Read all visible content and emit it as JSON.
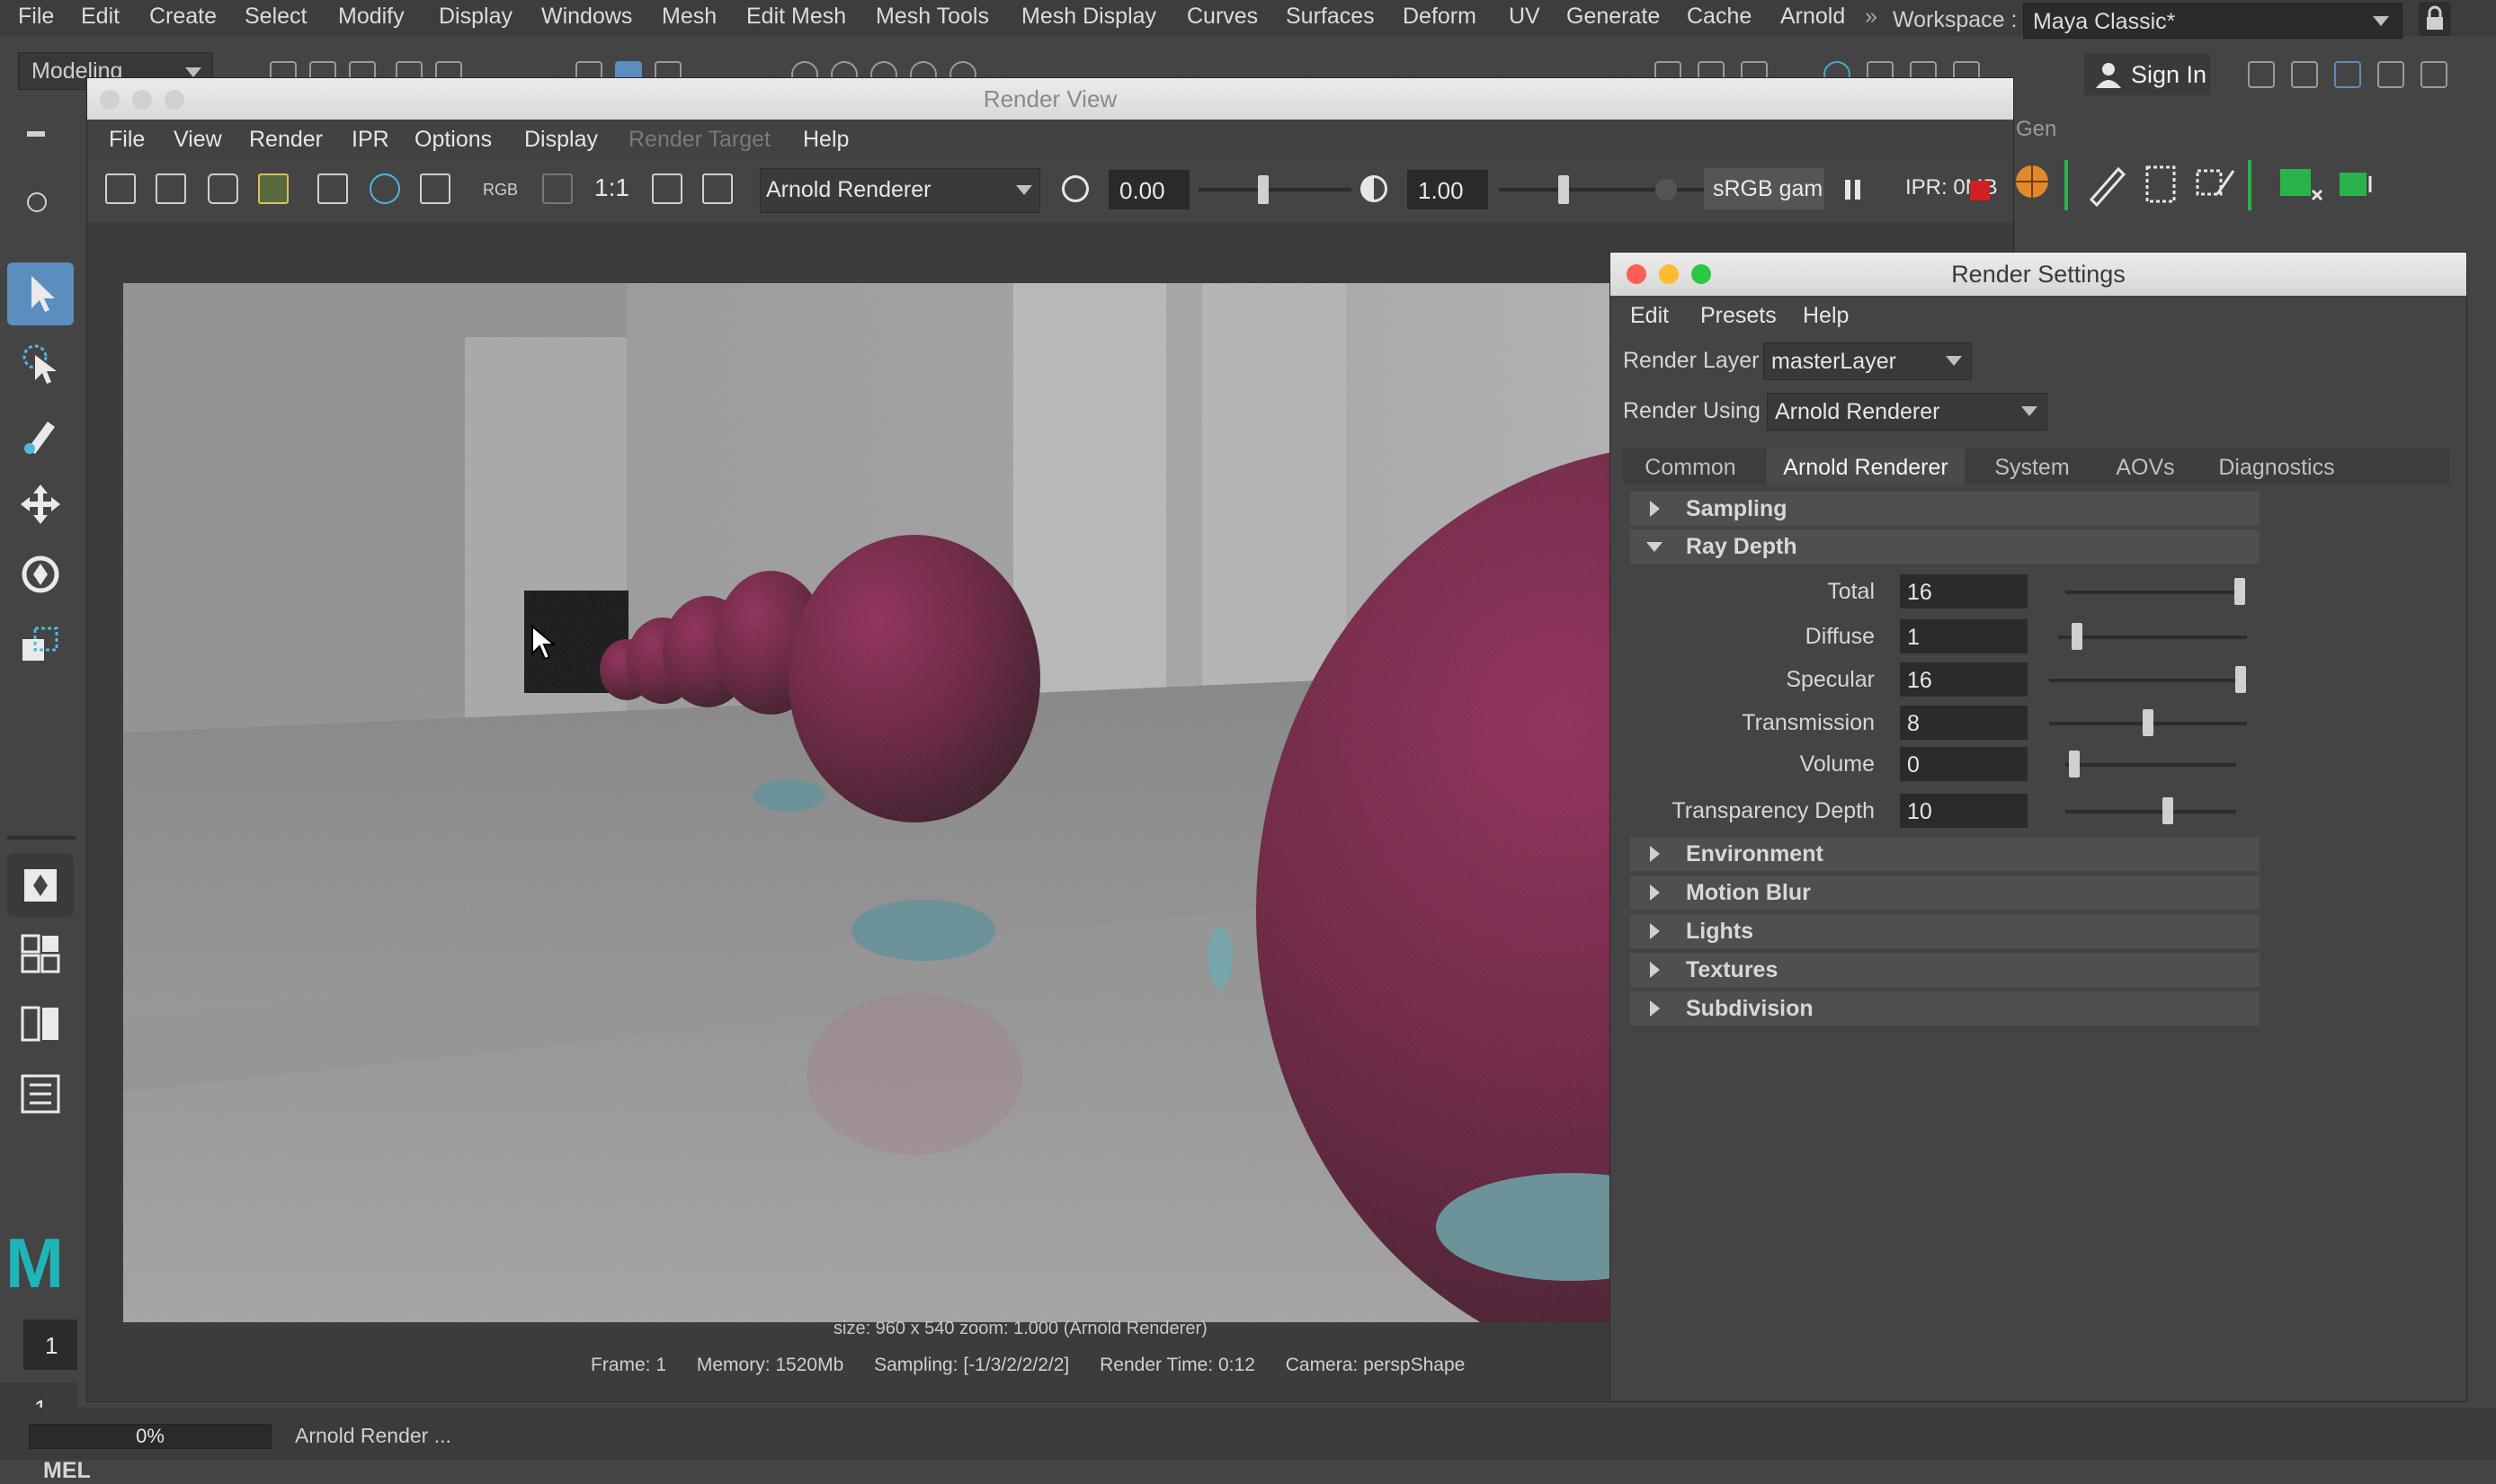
{
  "main_menu": {
    "items": [
      "File",
      "Edit",
      "Create",
      "Select",
      "Modify",
      "Display",
      "Windows",
      "Mesh",
      "Edit Mesh",
      "Mesh Tools",
      "Mesh Display",
      "Curves",
      "Surfaces",
      "Deform",
      "UV",
      "Generate",
      "Cache",
      "Arnold"
    ],
    "workspace_label": "Workspace :",
    "workspace_value": "Maya Classic*"
  },
  "shelf": {
    "mode": "Modeling",
    "sign_in": "Sign In",
    "gen_label": "Gen"
  },
  "toolbox": {
    "frame_start": "1",
    "frame_current": "1",
    "mel_label": "MEL"
  },
  "help_line": {
    "progress_text": "0%",
    "progress_value": 0,
    "text": "Arnold Render ..."
  },
  "render_view": {
    "title": "Render View",
    "menu": [
      "File",
      "View",
      "Render",
      "IPR",
      "Options",
      "Display",
      "Render Target",
      "Help"
    ],
    "toolbar": {
      "rgb_label": "RGB",
      "ratio_label": "1:1",
      "renderer": "Arnold Renderer",
      "exposure": "0.00",
      "gamma": "1.00",
      "color_space": "sRGB gam",
      "ipr_memory": "IPR: 0MB"
    },
    "status_line1": "size: 960 x 540  zoom: 1.000     (Arnold Renderer)",
    "status_line2": {
      "frame": "Frame: 1",
      "memory": "Memory: 1520Mb",
      "sampling": "Sampling: [-1/3/2/2/2/2]",
      "render_time": "Render Time: 0:12",
      "camera": "Camera: perspShape"
    }
  },
  "render_settings": {
    "title": "Render Settings",
    "menu": [
      "Edit",
      "Presets",
      "Help"
    ],
    "render_layer_label": "Render Layer",
    "render_layer_value": "masterLayer",
    "render_using_label": "Render Using",
    "render_using_value": "Arnold Renderer",
    "tabs": [
      "Common",
      "Arnold Renderer",
      "System",
      "AOVs",
      "Diagnostics"
    ],
    "active_tab": "Arnold Renderer",
    "sections": {
      "sampling": "Sampling",
      "ray_depth": "Ray Depth",
      "environment": "Environment",
      "motion_blur": "Motion Blur",
      "lights": "Lights",
      "textures": "Textures",
      "subdivision": "Subdivision"
    },
    "ray_depth": [
      {
        "label": "Total",
        "value": "16",
        "slider": 0.97
      },
      {
        "label": "Diffuse",
        "value": "1",
        "slider": 0.1
      },
      {
        "label": "Specular",
        "value": "16",
        "slider": 0.97
      },
      {
        "label": "Transmission",
        "value": "8",
        "slider": 0.5
      },
      {
        "label": "Volume",
        "value": "0",
        "slider": 0.05
      },
      {
        "label": "Transparency Depth",
        "value": "10",
        "slider": 0.6
      }
    ]
  },
  "colors": {
    "accent": "#5b8dbf",
    "maya_teal": "#1fb4b8",
    "sphere": "#6a0f36",
    "stop_red": "#d12020"
  }
}
